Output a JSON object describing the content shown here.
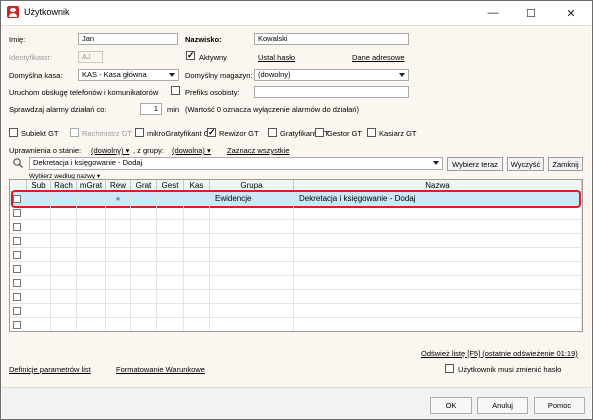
{
  "window": {
    "title": "Użytkownik",
    "minimize": "—",
    "maximize": "☐",
    "close": "✕"
  },
  "form": {
    "imie_label": "Imię:",
    "imie_value": "Jan",
    "nazwisko_label": "Nazwisko:",
    "nazwisko_value": "Kowalski",
    "identyfikator_label": "Identyfikator:",
    "identyfikator_value": "AJ",
    "aktywny_label": "Aktywny",
    "aktywny_checked": true,
    "ustal_haslo": "Ustal hasło",
    "dane_adresowe": "Dane adresowe",
    "kasa_label": "Domyślna kasa:",
    "kasa_value": "KAS - Kasa główna",
    "magazyn_label": "Domyślny magazyn:",
    "magazyn_value": "(dowolny)",
    "uruchom_label": "Uruchom obsługę telefonów i komunikatorów",
    "prefiks_label": "Prefiks osobisty:",
    "prefiks_value": "",
    "alarmy_label": "Sprawdzaj alarmy działań co:",
    "alarmy_value": "1",
    "alarmy_unit": "min",
    "alarmy_note": "(Wartość 0 oznacza wyłączenie alarmów do działań)"
  },
  "modules": [
    {
      "label": "Subiekt GT",
      "checked": false,
      "disabled": false
    },
    {
      "label": "Rachmistrz GT",
      "checked": false,
      "disabled": true
    },
    {
      "label": "mikroGratyfikant GT",
      "checked": false,
      "disabled": false
    },
    {
      "label": "Rewizor GT",
      "checked": true,
      "disabled": false
    },
    {
      "label": "Gratyfikant GT",
      "checked": false,
      "disabled": false
    },
    {
      "label": "Gestor GT",
      "checked": false,
      "disabled": false
    },
    {
      "label": "Kasiarz GT",
      "checked": false,
      "disabled": false
    }
  ],
  "permissions": {
    "stan_label": "Uprawnienia o stanie:",
    "stan_value": "(dowolny)",
    "grupa_label": ", z grupy:",
    "grupa_value": "(dowolna)",
    "zaznacz": "Zaznacz wszystkie",
    "selected_permission": "Dekretacja i księgowanie - Dodaj",
    "btn_wybierz": "Wybierz teraz",
    "btn_wyczysc": "Wyczyść",
    "btn_zamknij": "Zamknij",
    "wybierz_wedlug": "Wybierz według nazwy"
  },
  "grid": {
    "columns": [
      "",
      "Sub",
      "Rach",
      "mGrat",
      "Rew",
      "Grat",
      "Gest",
      "Kas",
      "Grupa",
      "Nazwa"
    ],
    "rows": [
      {
        "grupa": "Ewidencje",
        "nazwa": "Dekretacja i księgowanie - Dodaj",
        "rew": "●",
        "selected": true
      },
      {
        "grupa": "",
        "nazwa": "",
        "rew": "",
        "selected": false
      },
      {
        "grupa": "",
        "nazwa": "",
        "rew": "",
        "selected": false
      },
      {
        "grupa": "",
        "nazwa": "",
        "rew": "",
        "selected": false
      },
      {
        "grupa": "",
        "nazwa": "",
        "rew": "",
        "selected": false
      },
      {
        "grupa": "",
        "nazwa": "",
        "rew": "",
        "selected": false
      },
      {
        "grupa": "",
        "nazwa": "",
        "rew": "",
        "selected": false
      },
      {
        "grupa": "",
        "nazwa": "",
        "rew": "",
        "selected": false
      },
      {
        "grupa": "",
        "nazwa": "",
        "rew": "",
        "selected": false
      },
      {
        "grupa": "",
        "nazwa": "",
        "rew": "",
        "selected": false
      }
    ],
    "highlight_color": "#d82020",
    "selected_bg": "#cde6f7"
  },
  "bottom": {
    "odswiez": "Odśwież listę [F5] (ostatnie odświeżenie 01:19)",
    "definicje": "Definicje parametrów list",
    "formatowanie": "Formatowanie Warunkowe",
    "musi_zmienic": "Użytkownik musi zmienić hasło"
  },
  "footer": {
    "ok": "OK",
    "anuluj": "Anuluj",
    "pomoc": "Pomoc"
  }
}
